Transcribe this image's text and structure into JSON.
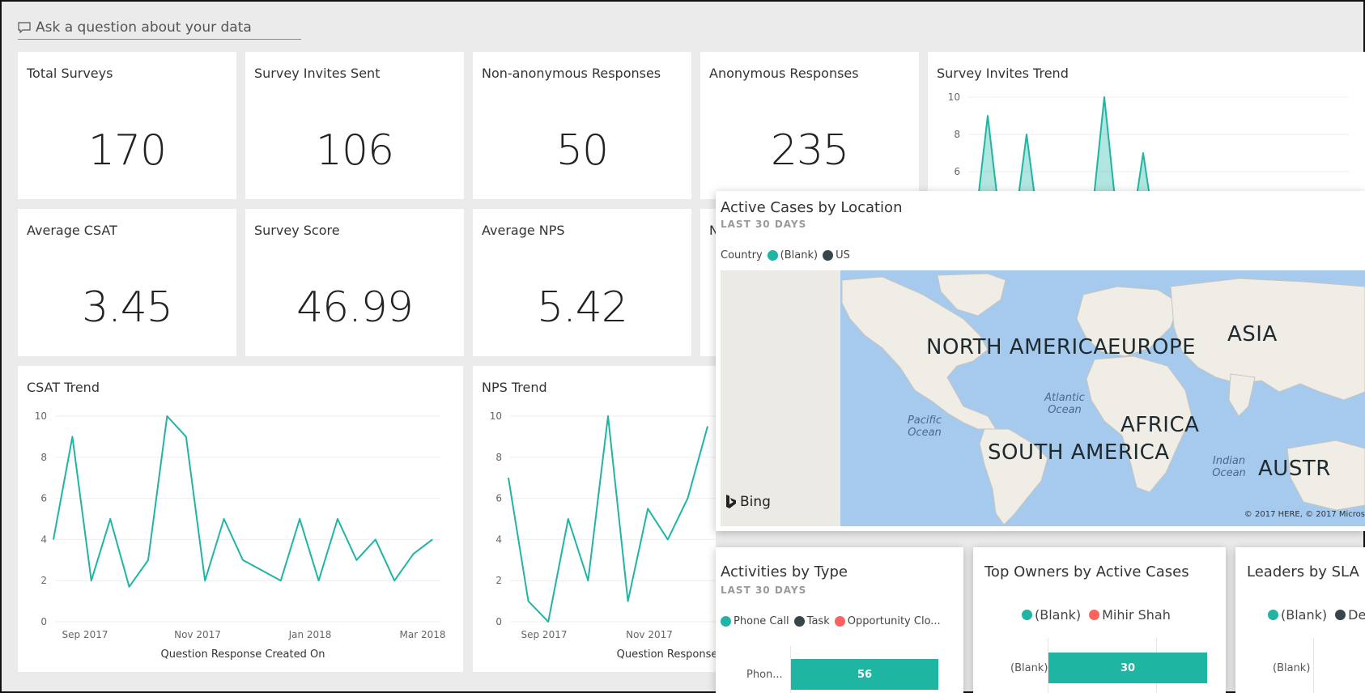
{
  "qa": {
    "placeholder": "Ask a question about your data"
  },
  "kpis": [
    {
      "title": "Total Surveys",
      "value": "170"
    },
    {
      "title": "Survey Invites Sent",
      "value": "106"
    },
    {
      "title": "Non-anonymous Responses",
      "value": "50"
    },
    {
      "title": "Anonymous Responses",
      "value": "235"
    },
    {
      "title": "Average CSAT",
      "value": "3.45"
    },
    {
      "title": "Survey Score",
      "value": "46.99"
    },
    {
      "title": "Average NPS",
      "value": "5.42"
    },
    {
      "title": "N",
      "value": ""
    }
  ],
  "survey_invites_trend": {
    "title": "Survey Invites Trend"
  },
  "csat_trend": {
    "title": "CSAT Trend"
  },
  "nps_trend": {
    "title": "NPS Trend"
  },
  "map": {
    "title": "Active Cases by Location",
    "subtitle": "LAST 30 DAYS",
    "legend_label": "Country",
    "legend_items": [
      {
        "label": "(Blank)",
        "color": "#1fb5a3"
      },
      {
        "label": "US",
        "color": "#374649"
      }
    ],
    "regions": {
      "north_america": "NORTH AMERICA",
      "south_america": "SOUTH AMERICA",
      "europe": "EUROPE",
      "asia": "ASIA",
      "africa": "AFRICA",
      "australia": "AUSTR"
    },
    "oceans": {
      "pacific": "Pacific Ocean",
      "atlantic": "Atlantic Ocean",
      "indian": "Indian Ocean"
    },
    "bing_label": "Bing",
    "copyright": "© 2017 HERE, © 2017 Micros"
  },
  "activities": {
    "title": "Activities by Type",
    "subtitle": "LAST 30 DAYS",
    "legend_items": [
      {
        "label": "Phone Call",
        "color": "#1fb5a3"
      },
      {
        "label": "Task",
        "color": "#374649"
      },
      {
        "label": "Opportunity Clo...",
        "color": "#fd625e"
      }
    ],
    "bar_category": "Phon...",
    "bar_value": "56"
  },
  "top_owners": {
    "title": "Top Owners by Active Cases",
    "legend_items": [
      {
        "label": "(Blank)",
        "color": "#1fb5a3"
      },
      {
        "label": "Mihir Shah",
        "color": "#fd625e"
      }
    ],
    "bar_category": "(Blank)",
    "bar_value": "30"
  },
  "leaders": {
    "title": "Leaders by SLA M",
    "legend_items": [
      {
        "label": "(Blank)",
        "color": "#1fb5a3"
      },
      {
        "label": "Del",
        "color": "#374649"
      }
    ],
    "bar_category": "(Blank)"
  },
  "chart_data": [
    {
      "type": "area",
      "title": "Survey Invites Trend",
      "y_ticks": [
        "10",
        "8",
        "6"
      ],
      "ylim": [
        0,
        10
      ],
      "series": [
        {
          "values": [
            0,
            9,
            0,
            8,
            0,
            0,
            0,
            10,
            0,
            7,
            0
          ]
        }
      ]
    },
    {
      "type": "line",
      "title": "CSAT Trend",
      "xlabel": "Question Response Created On",
      "x_ticks": [
        "Sep 2017",
        "Nov 2017",
        "Jan 2018",
        "Mar 2018"
      ],
      "y_ticks": [
        "10",
        "8",
        "6",
        "4",
        "2",
        "0"
      ],
      "ylim": [
        0,
        10
      ],
      "series": [
        {
          "values": [
            4,
            9,
            2,
            5,
            1.7,
            3,
            10,
            9,
            2,
            5,
            3,
            2.5,
            2,
            5,
            2,
            5,
            3,
            4,
            2,
            3.3,
            4
          ]
        }
      ]
    },
    {
      "type": "line",
      "title": "NPS Trend",
      "xlabel": "Question Response",
      "x_ticks": [
        "Sep 2017",
        "Nov 2017"
      ],
      "y_ticks": [
        "10",
        "8",
        "6",
        "4",
        "2",
        "0"
      ],
      "ylim": [
        0,
        10
      ],
      "series": [
        {
          "values": [
            7,
            1,
            0,
            5,
            2,
            10,
            1,
            5.5,
            4,
            6,
            9.5
          ]
        }
      ]
    }
  ]
}
